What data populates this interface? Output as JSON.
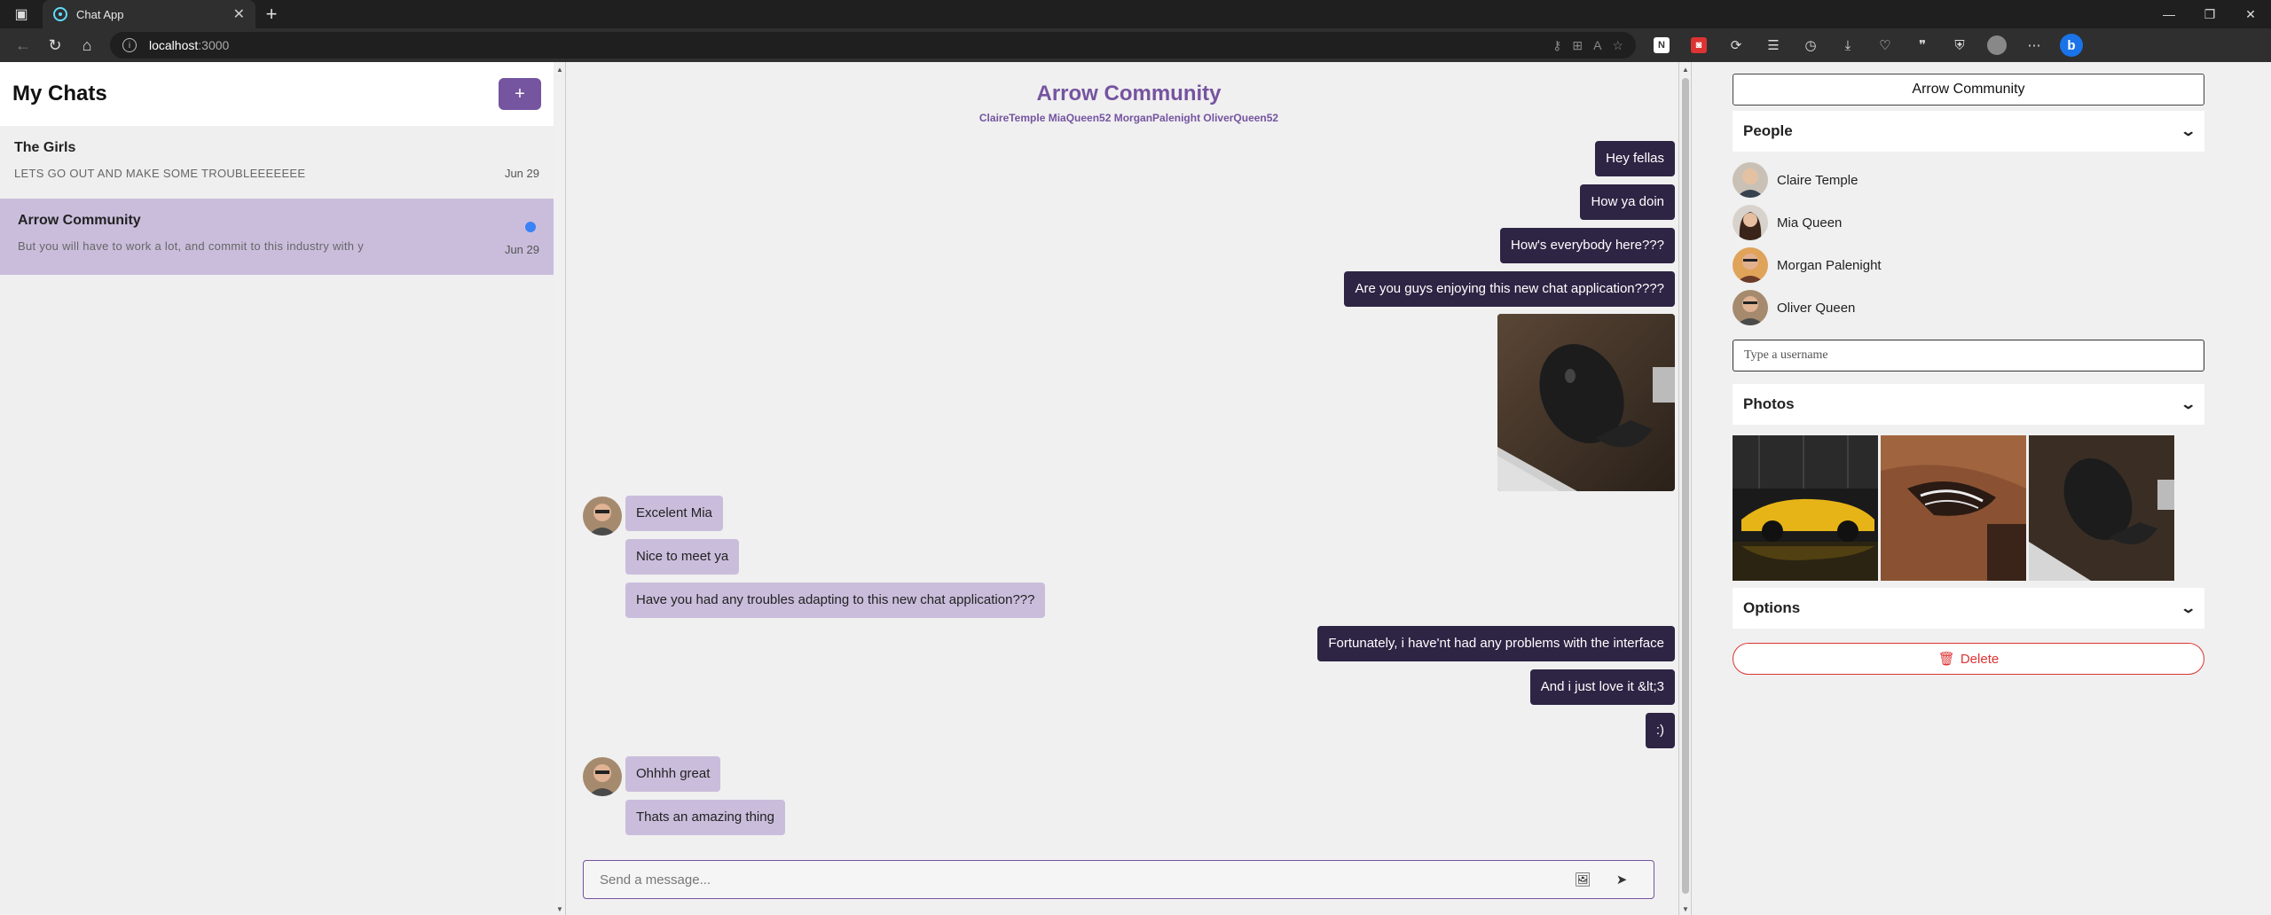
{
  "browser": {
    "tab_title": "Chat App",
    "url_host": "localhost",
    "url_port": ":3000"
  },
  "chat_list": {
    "title": "My Chats",
    "add_label": "+",
    "chats": [
      {
        "title": "The Girls",
        "preview": "LETS GO OUT AND MAKE SOME TROUBLEEEEEEE",
        "date": "Jun 29",
        "active": false
      },
      {
        "title": "Arrow Community",
        "preview": "But you will have to work a lot, and commit to this industry with y",
        "date": "Jun 29",
        "active": true
      }
    ]
  },
  "feed": {
    "title": "Arrow Community",
    "subtitle": "ClaireTemple MiaQueen52 MorganPalenight OliverQueen52",
    "messages": [
      {
        "text": "Hey fellas",
        "mine": true
      },
      {
        "text": "How ya doin",
        "mine": true
      },
      {
        "text": "How's everybody here???",
        "mine": true
      },
      {
        "text": "Are you guys enjoying this new chat application????",
        "mine": true
      },
      {
        "text": "Excelent Mia",
        "mine": false
      },
      {
        "text": "Nice to meet ya",
        "mine": false
      },
      {
        "text": "Have you had any troubles adapting to this new chat application???",
        "mine": false
      },
      {
        "text": "Fortunately, i have'nt had any problems with the interface",
        "mine": true
      },
      {
        "text": "And i just love it &lt;3",
        "mine": true
      },
      {
        "text": ":)",
        "mine": true
      },
      {
        "text": "Ohhhh great",
        "mine": false
      },
      {
        "text": "Thats an amazing thing",
        "mine": false
      }
    ],
    "composer_placeholder": "Send a message..."
  },
  "settings": {
    "title": "Arrow Community",
    "people_label": "People",
    "people": [
      "Claire Temple",
      "Mia Queen",
      "Morgan Palenight",
      "Oliver Queen"
    ],
    "username_placeholder": "Type a username",
    "photos_label": "Photos",
    "options_label": "Options",
    "delete_label": "Delete"
  },
  "colors": {
    "accent": "#7554a0",
    "my_bubble": "#2e2444",
    "their_bubble": "#cabddc",
    "unread": "#3b82f6",
    "danger": "#dd3333"
  }
}
